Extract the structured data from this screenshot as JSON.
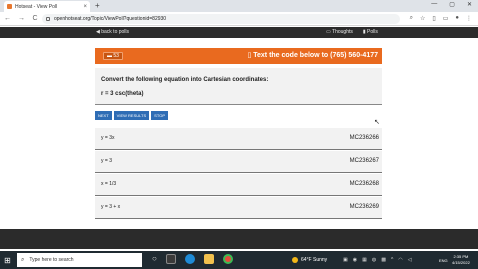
{
  "browser": {
    "tab_title": "Hotseat - View Poll",
    "tab_close": "×",
    "new_tab": "+",
    "win_controls": [
      "—",
      "▢",
      "✕"
    ],
    "nav": [
      "←",
      "→",
      "C"
    ],
    "url": "openhotseat.org/Topic/ViewPoll?questionid=82930",
    "toolbar_icons": [
      "⌕",
      "☆",
      "▯",
      "▭",
      "●",
      "⋮"
    ]
  },
  "site_nav": {
    "back_label": "◀ back to polls",
    "thoughts_label": "Thoughts",
    "polls_label": "Polls"
  },
  "poll": {
    "count": "53",
    "cta": "Text the code below to (765) 560-4177",
    "question_title": "Convert the following equation into Cartesian coordinates:",
    "question_sub": "r = 3 csc(theta)"
  },
  "buttons": {
    "next": "NEXT",
    "view_results": "VIEW RESULTS",
    "stop": "STOP"
  },
  "answers": [
    {
      "text": "y = 3x",
      "code": "MC236266"
    },
    {
      "text": "y = 3",
      "code": "MC236267"
    },
    {
      "text": "x = 1/3",
      "code": "MC236268"
    },
    {
      "text": "y = 3 + x",
      "code": "MC236269"
    }
  ],
  "taskbar": {
    "start_glyph": "⊞",
    "search_placeholder": "Type here to search",
    "weather": "64°F  Sunny",
    "lang": "ENG",
    "time": "2:35 PM",
    "date": "4/15/2022"
  },
  "colors": {
    "orange_bar": "#e96a1f",
    "button_blue": "#2f6db5",
    "dark_nav": "#2b2b2b"
  }
}
